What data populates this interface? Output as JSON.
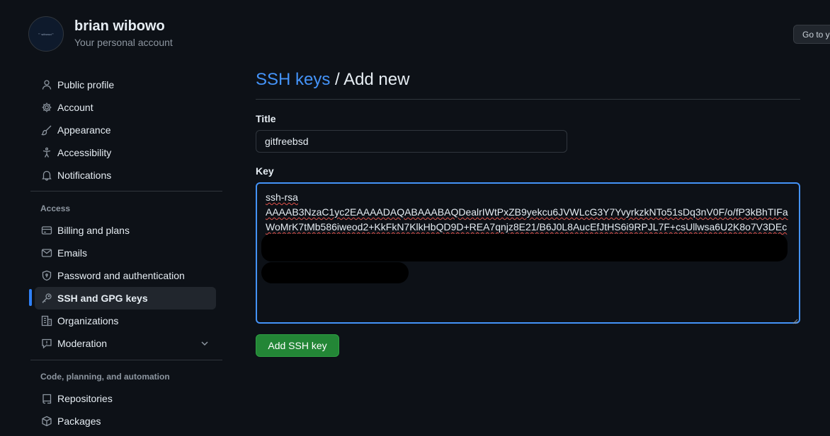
{
  "account": {
    "avatar_text": "\"\" wibowo\"\"",
    "name": "brian wibowo",
    "subtitle": "Your personal account",
    "goto_label": "Go to your personal profile"
  },
  "sidebar": {
    "items": [
      {
        "label": "Public profile",
        "icon": "person-icon"
      },
      {
        "label": "Account",
        "icon": "gear-icon"
      },
      {
        "label": "Appearance",
        "icon": "paintbrush-icon"
      },
      {
        "label": "Accessibility",
        "icon": "accessibility-icon"
      },
      {
        "label": "Notifications",
        "icon": "bell-icon"
      }
    ],
    "access_heading": "Access",
    "access_items": [
      {
        "label": "Billing and plans",
        "icon": "credit-card-icon"
      },
      {
        "label": "Emails",
        "icon": "mail-icon"
      },
      {
        "label": "Password and authentication",
        "icon": "shield-lock-icon"
      },
      {
        "label": "SSH and GPG keys",
        "icon": "key-icon",
        "active": true
      },
      {
        "label": "Organizations",
        "icon": "organization-icon"
      },
      {
        "label": "Moderation",
        "icon": "report-icon"
      }
    ],
    "code_heading": "Code, planning, and automation",
    "code_items": [
      {
        "label": "Repositories",
        "icon": "repo-icon"
      },
      {
        "label": "Packages",
        "icon": "package-icon"
      }
    ]
  },
  "main": {
    "breadcrumb_link": "SSH keys",
    "breadcrumb_sep": " / ",
    "breadcrumb_current": "Add new",
    "title_label": "Title",
    "title_value": "gitfreebsd",
    "key_label": "Key",
    "key_line1": "ssh-rsa",
    "key_line2": "AAAAB3NzaC1yc2EAAAADAQABAAABAQDealrIWtPxZB9yekcu6JVWLcG3Y7YvyrkzkNTo51sDq3nV0F/o/fP3kBhTIFa",
    "key_line3": "WoMrK7tMb586iweod2+KkFkN7KlkHbQD9D+REA7qnjz8E21/B6J0L8AucEfJtHS6i9RPJL7F+csUllwsa6U2K8o7V3DEc",
    "submit_label": "Add SSH key"
  },
  "colors": {
    "background": "#0d1117",
    "accent": "#4493f8",
    "active_indicator": "#2f81f7",
    "button_green": "#238636",
    "muted_text": "#8d96a0"
  }
}
